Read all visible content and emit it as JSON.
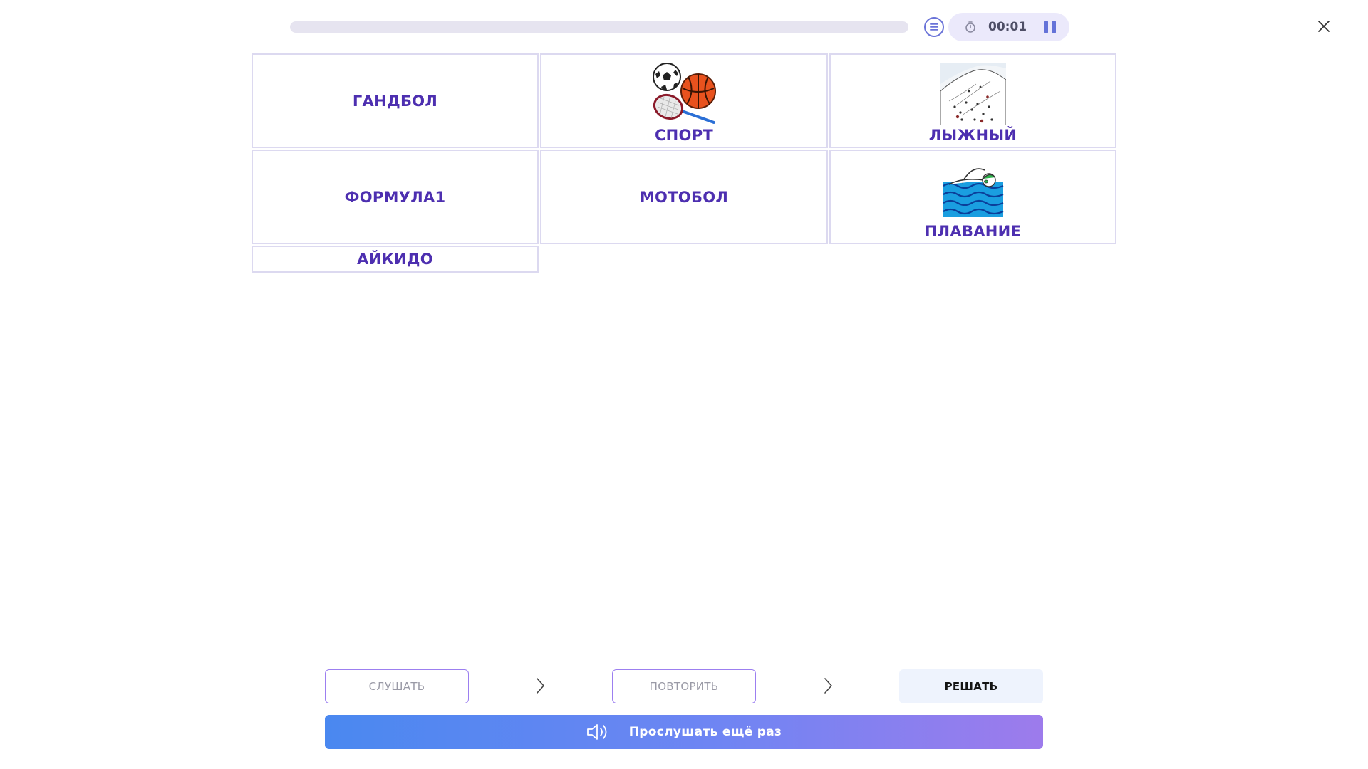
{
  "header": {
    "progress_fraction": 0,
    "timer": "00:01"
  },
  "cards": [
    {
      "label": "ГАНДБОЛ",
      "has_image": false,
      "image": ""
    },
    {
      "label": "СПОРТ",
      "has_image": true,
      "image": "sports-balls-icon"
    },
    {
      "label": "ЛЫЖНЫЙ",
      "has_image": true,
      "image": "ski-slope-icon"
    },
    {
      "label": "ФОРМУЛА1",
      "has_image": false,
      "image": ""
    },
    {
      "label": "МОТОБОЛ",
      "has_image": false,
      "image": ""
    },
    {
      "label": "ПЛАВАНИЕ",
      "has_image": true,
      "image": "swimmer-icon"
    },
    {
      "label": "АЙКИДО",
      "has_image": false,
      "image": ""
    }
  ],
  "steps": {
    "listen": "СЛУШАТЬ",
    "repeat": "ПОВТОРИТЬ",
    "solve": "РЕШАТЬ"
  },
  "listen_again_label": "Прослушать ещё раз",
  "colors": {
    "label": "#4d2fb0",
    "card_border": "#dcd9f0",
    "accent": "#6472d8",
    "gradient_start": "#4a88f0",
    "gradient_end": "#9d7bec"
  }
}
